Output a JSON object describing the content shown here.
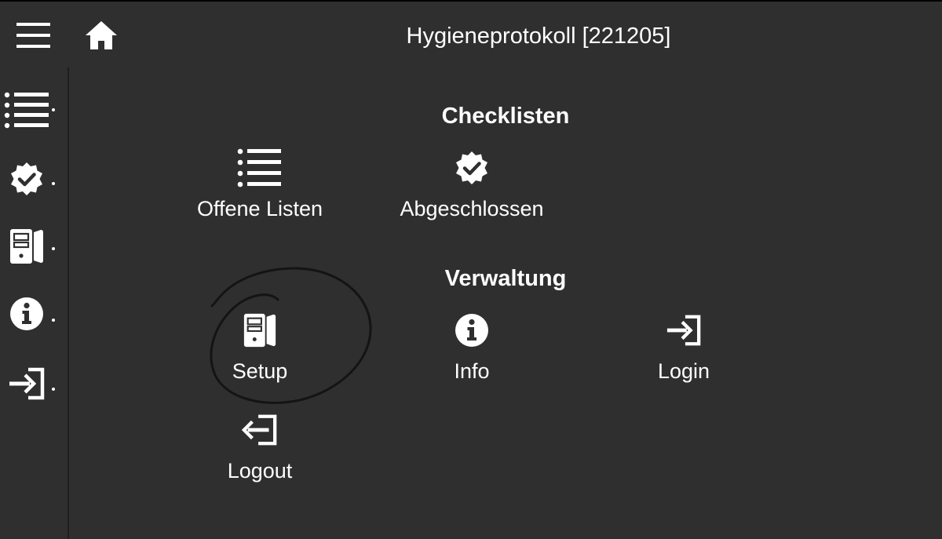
{
  "header": {
    "title": "Hygieneprotokoll [221205]",
    "menu_icon": "hamburger-menu-icon",
    "home_icon": "home-icon"
  },
  "rail": {
    "items": [
      {
        "icon": "list-icon",
        "target": "Offene Listen"
      },
      {
        "icon": "check-badge-icon",
        "target": "Abgeschlossen"
      },
      {
        "icon": "server-icon",
        "target": "Setup"
      },
      {
        "icon": "info-icon",
        "target": "Info"
      },
      {
        "icon": "login-icon",
        "target": "Login"
      }
    ]
  },
  "sections": {
    "checklisten": {
      "title": "Checklisten",
      "tiles": [
        {
          "label": "Offene Listen",
          "icon": "list-icon"
        },
        {
          "label": "Abgeschlossen",
          "icon": "check-badge-icon"
        }
      ]
    },
    "verwaltung": {
      "title": "Verwaltung",
      "tiles": [
        {
          "label": "Setup",
          "icon": "server-icon"
        },
        {
          "label": "Info",
          "icon": "info-icon"
        },
        {
          "label": "Login",
          "icon": "login-icon"
        },
        {
          "label": "Logout",
          "icon": "logout-icon"
        }
      ]
    }
  },
  "colors": {
    "background": "#2f2f2f",
    "foreground": "#ffffff",
    "annotation": "#111111"
  }
}
